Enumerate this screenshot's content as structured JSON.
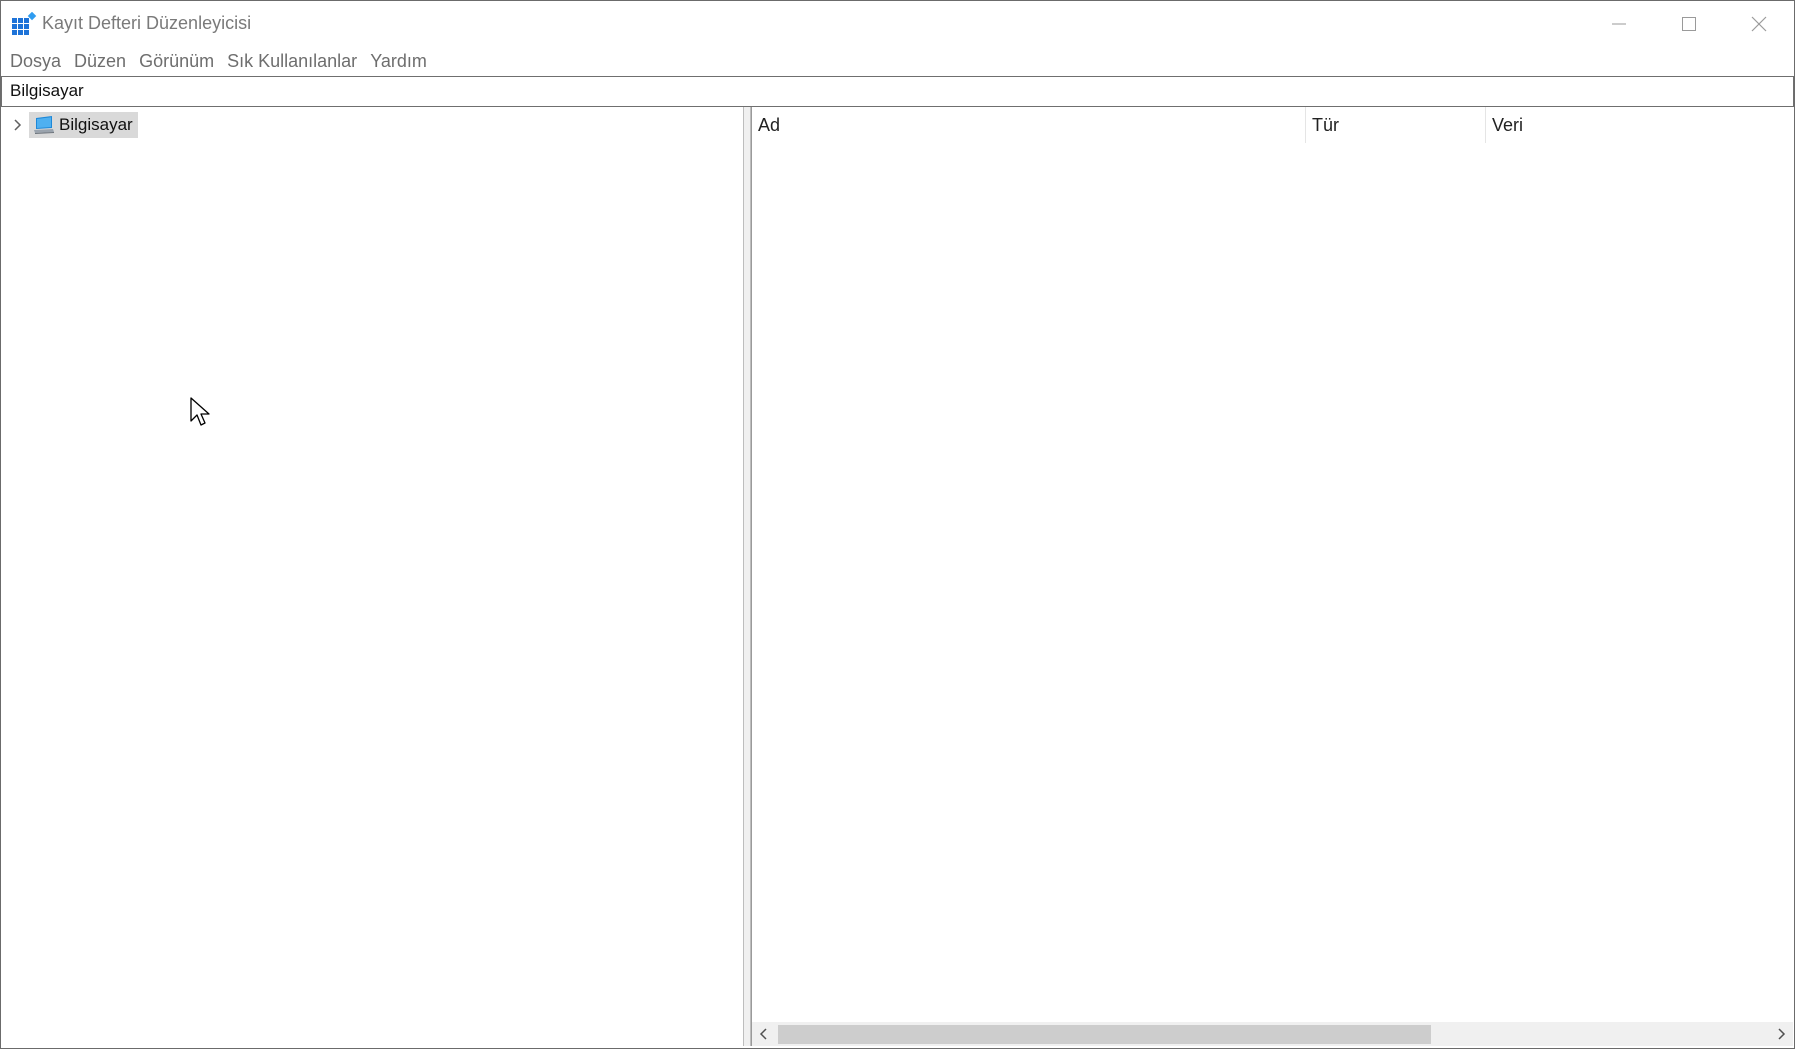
{
  "window": {
    "title": "Kayıt Defteri Düzenleyicisi",
    "app_icon": "registry-icon",
    "controls": {
      "minimize_icon": "minimize-icon",
      "maximize_icon": "maximize-icon",
      "close_icon": "close-icon"
    }
  },
  "menu": {
    "items": [
      {
        "label": "Dosya"
      },
      {
        "label": "Düzen"
      },
      {
        "label": "Görünüm"
      },
      {
        "label": "Sık Kullanılanlar"
      },
      {
        "label": "Yardım"
      }
    ]
  },
  "address": {
    "value": "Bilgisayar"
  },
  "tree": {
    "root": {
      "label": "Bilgisayar",
      "icon": "computer-icon",
      "expander_icon": "chevron-right-icon",
      "selected": true,
      "expanded": false
    }
  },
  "list": {
    "columns": [
      {
        "label": "Ad"
      },
      {
        "label": "Tür"
      },
      {
        "label": "Veri"
      }
    ],
    "rows": []
  },
  "scrollbar": {
    "left_icon": "chevron-left-icon",
    "right_icon": "chevron-right-icon"
  },
  "colors": {
    "window_bg": "#ffffff",
    "selection_bg": "#d9d9d9",
    "menu_text": "#6e6e6e",
    "scroll_thumb": "#cdcdcd",
    "icon_blue": "#1e88d8"
  }
}
